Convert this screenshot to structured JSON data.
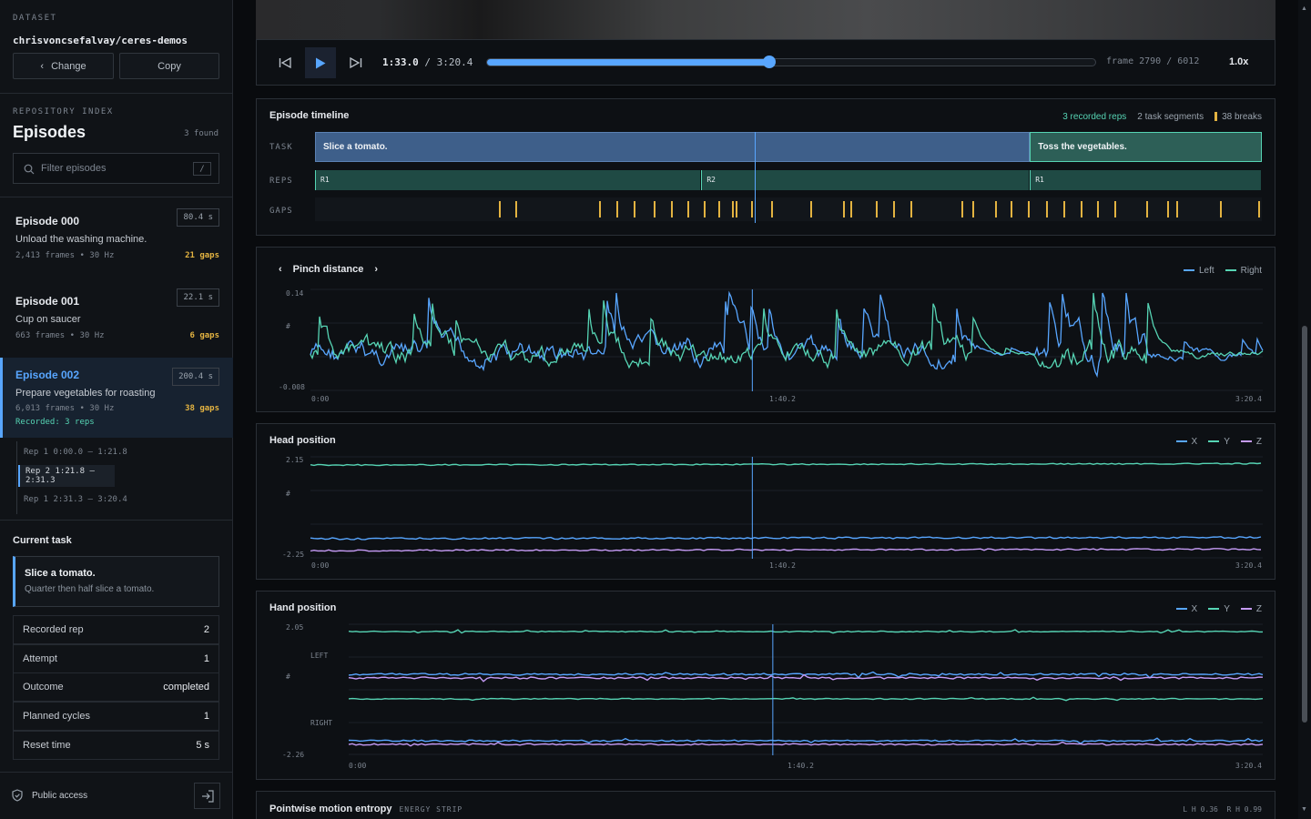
{
  "sidebar": {
    "dataset_label": "DATASET",
    "dataset_name": "chrisvoncsefalvay/ceres-demos",
    "change_label": "Change",
    "copy_label": "Copy",
    "repo_label": "REPOSITORY INDEX",
    "episodes_title": "Episodes",
    "found": "3 found",
    "filter_placeholder": "Filter episodes",
    "filter_shortcut": "/",
    "episodes": [
      {
        "title": "Episode 000",
        "duration": "80.4 s",
        "desc": "Unload the washing machine.",
        "meta": "2,413 frames • 30 Hz",
        "gaps": "21 gaps"
      },
      {
        "title": "Episode 001",
        "duration": "22.1 s",
        "desc": "Cup on saucer",
        "meta": "663 frames • 30 Hz",
        "gaps": "6 gaps"
      },
      {
        "title": "Episode 002",
        "duration": "200.4 s",
        "desc": "Prepare vegetables for roasting",
        "meta": "6,013 frames • 30 Hz",
        "gaps": "38 gaps",
        "recorded": "Recorded: 3 reps"
      }
    ],
    "reps": [
      "Rep 1 0:00.0 – 1:21.8",
      "Rep 2 1:21.8 – 2:31.3",
      "Rep 1 2:31.3 – 3:20.4"
    ],
    "current_task_label": "Current task",
    "task_title": "Slice a tomato.",
    "task_desc": "Quarter then half slice a tomato.",
    "props": [
      {
        "k": "Recorded rep",
        "v": "2"
      },
      {
        "k": "Attempt",
        "v": "1"
      },
      {
        "k": "Outcome",
        "v": "completed"
      },
      {
        "k": "Planned cycles",
        "v": "1"
      },
      {
        "k": "Reset time",
        "v": "5 s"
      }
    ],
    "access": "Public access"
  },
  "player": {
    "time": "1:33.0",
    "total": "/ 3:20.4",
    "frame": "frame 2790 / 6012",
    "speed": "1.0x",
    "progress": 0.464
  },
  "timeline": {
    "title": "Episode timeline",
    "reps_count": "3 recorded reps",
    "segments": "2 task segments",
    "breaks": "38 breaks",
    "row_task": "TASK",
    "row_reps": "REPS",
    "row_gaps": "GAPS",
    "task1": "Slice a tomato.",
    "task2": "Toss the vegetables.",
    "rep_labels": [
      "R1",
      "R2",
      "R1"
    ],
    "task_split": 0.755,
    "rep_splits": [
      0.408,
      0.755
    ],
    "playhead": 0.464,
    "gap_positions": [
      0.194,
      0.212,
      0.3,
      0.318,
      0.337,
      0.358,
      0.376,
      0.393,
      0.411,
      0.426,
      0.44,
      0.444,
      0.461,
      0.482,
      0.523,
      0.558,
      0.565,
      0.592,
      0.611,
      0.629,
      0.683,
      0.694,
      0.718,
      0.735,
      0.753,
      0.772,
      0.79,
      0.809,
      0.826,
      0.844,
      0.878,
      0.9,
      0.91,
      0.956,
      0.996
    ]
  },
  "pinch": {
    "title": "Pinch distance",
    "legend": [
      "Left",
      "Right"
    ],
    "ymax": "0.14",
    "ymid": "#",
    "ymin": "-0.008",
    "x0": "0:00",
    "x1": "1:40.2",
    "x2": "3:20.4"
  },
  "head": {
    "title": "Head position",
    "legend": [
      "X",
      "Y",
      "Z"
    ],
    "ymax": "2.15",
    "ymid": "#",
    "ymin": "-2.25",
    "x0": "0:00",
    "x1": "1:40.2",
    "x2": "3:20.4"
  },
  "hand": {
    "title": "Hand position",
    "legend": [
      "X",
      "Y",
      "Z"
    ],
    "ymax": "2.05",
    "ymid": "#",
    "ymin": "-2.26",
    "left": "LEFT",
    "right": "RIGHT",
    "x0": "0:00",
    "x1": "1:40.2",
    "x2": "3:20.4"
  },
  "entropy": {
    "title": "Pointwise motion entropy",
    "tag": "ENERGY STRIP",
    "readout": "L H 0.36  R H 0.99"
  },
  "colors": {
    "accent": "#58a6ff",
    "teal": "#56d4b4",
    "purple": "#c59bf5",
    "gap": "#e3b341",
    "task_bar": "#3e5f8a",
    "rep_bar": "#1f4a44"
  }
}
